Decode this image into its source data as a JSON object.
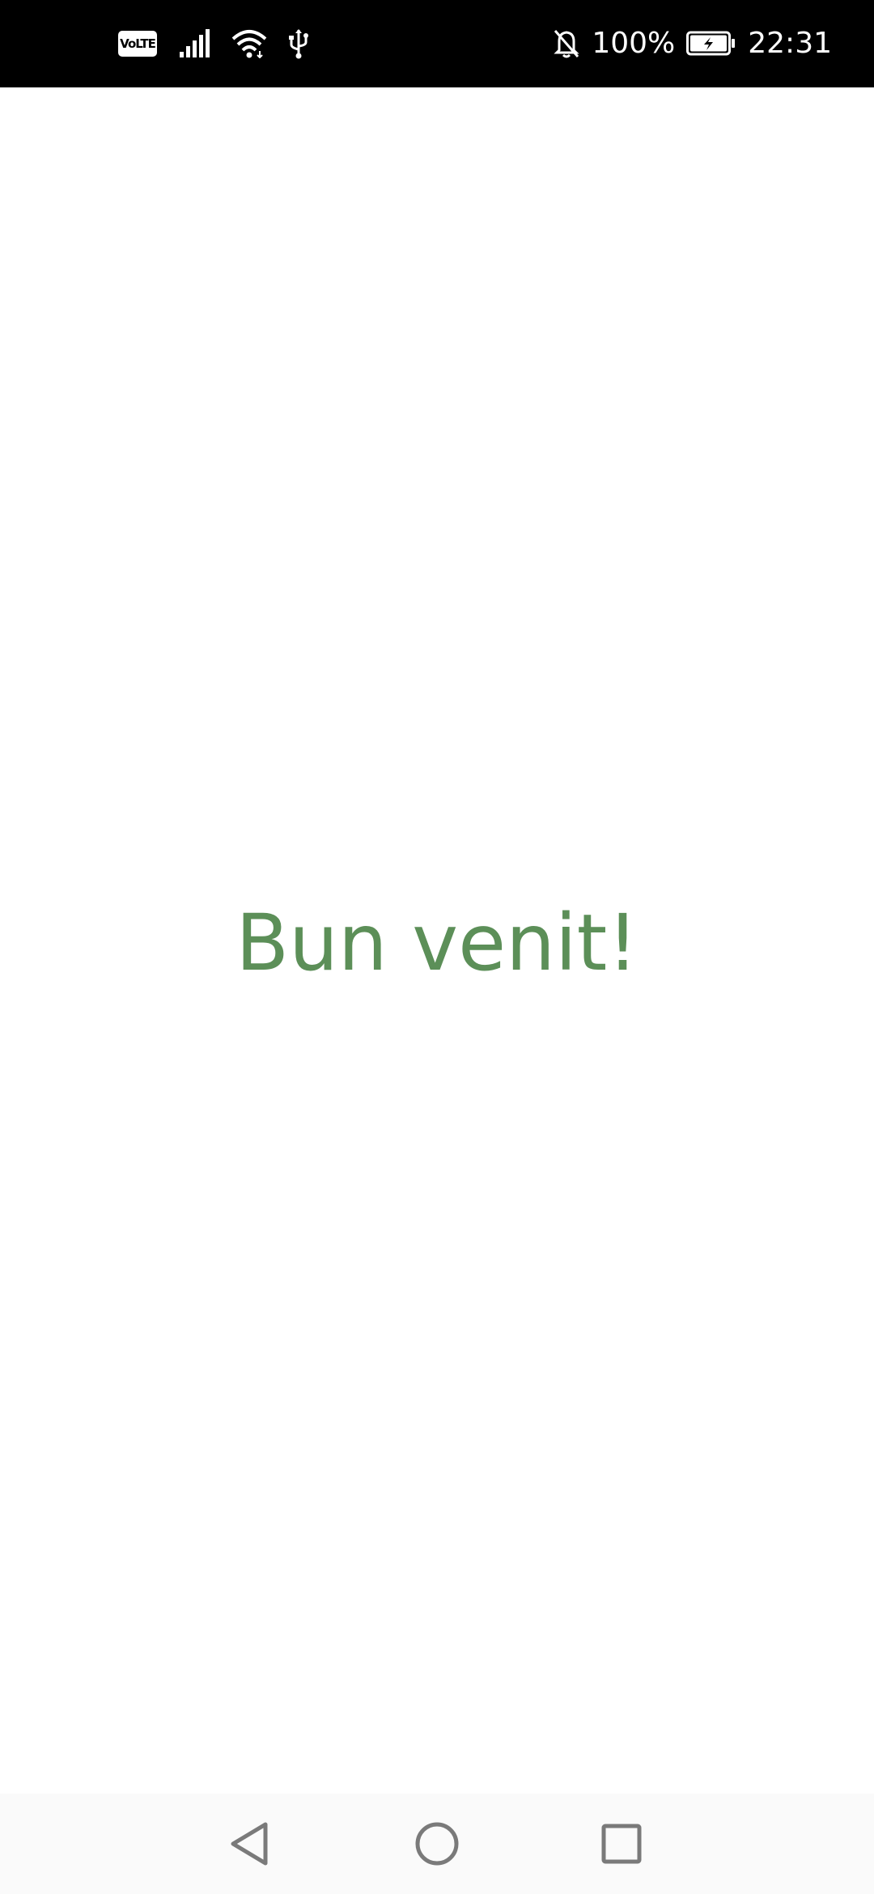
{
  "status_bar": {
    "volte_label": "VoLTE",
    "battery_percent": "100%",
    "time": "22:31",
    "icons": [
      "volte-icon",
      "signal-icon",
      "wifi-icon",
      "usb-icon",
      "bell-off-icon",
      "battery-charging-icon"
    ]
  },
  "main": {
    "welcome_text": "Bun venit!",
    "welcome_color": "#5c8f58"
  },
  "nav_bar": {
    "icons": [
      "back-icon",
      "home-icon",
      "recent-apps-icon"
    ]
  }
}
